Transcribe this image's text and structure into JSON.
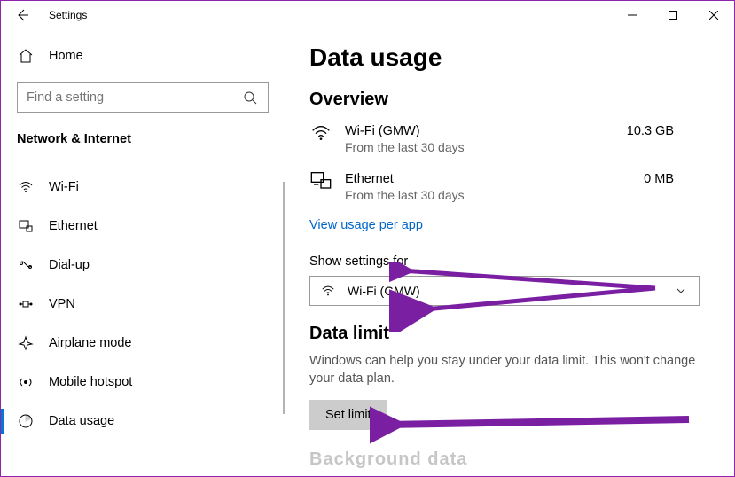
{
  "window": {
    "title": "Settings"
  },
  "sidebar": {
    "home": "Home",
    "search_placeholder": "Find a setting",
    "category": "Network & Internet",
    "items": [
      {
        "label": "Wi-Fi"
      },
      {
        "label": "Ethernet"
      },
      {
        "label": "Dial-up"
      },
      {
        "label": "VPN"
      },
      {
        "label": "Airplane mode"
      },
      {
        "label": "Mobile hotspot"
      },
      {
        "label": "Data usage"
      }
    ]
  },
  "main": {
    "title": "Data usage",
    "overview_heading": "Overview",
    "overview": [
      {
        "name": "Wi-Fi (GMW)",
        "sub": "From the last 30 days",
        "value": "10.3 GB"
      },
      {
        "name": "Ethernet",
        "sub": "From the last 30 days",
        "value": "0 MB"
      }
    ],
    "usage_link": "View usage per app",
    "show_for_label": "Show settings for",
    "show_for_value": "Wi-Fi (GMW)",
    "limit_heading": "Data limit",
    "limit_desc": "Windows can help you stay under your data limit. This won't change your data plan.",
    "set_limit_btn": "Set limit",
    "bg_heading_cut": "Background data"
  }
}
